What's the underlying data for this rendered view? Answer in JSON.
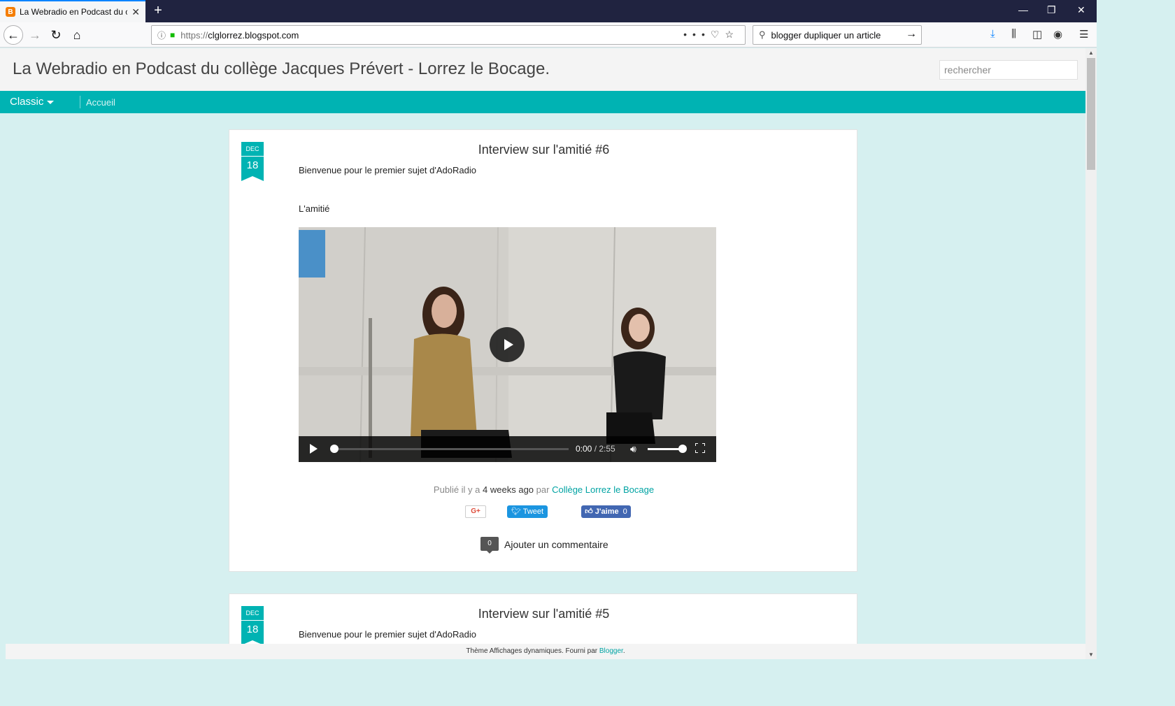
{
  "browser": {
    "tab_title": "La Webradio en Podcast du coll",
    "url_protocol": "https://",
    "url_host": "clglorrez.blogspot.com",
    "search_query": "blogger dupliquer un article"
  },
  "site": {
    "title": "La Webradio en Podcast du collège Jacques Prévert - Lorrez le Bocage.",
    "search_placeholder": "rechercher"
  },
  "menu": {
    "view_label": "Classic",
    "accueil": "Accueil"
  },
  "posts": [
    {
      "month": "DEC",
      "day": "18",
      "title": "Interview sur l'amitié #6",
      "intro": "Bienvenue pour le premier sujet d'AdoRadio",
      "subtitle": "L'amitié",
      "video": {
        "current_time": "0:00",
        "duration": "2:55",
        "progress": 0,
        "volume": 1.0
      },
      "meta_prefix": "Publié il y a",
      "meta_when": "4 weeks ago",
      "meta_by": "par",
      "author": "Collège Lorrez le Bocage",
      "share": {
        "gplus": "G+",
        "tweet": "Tweet",
        "like": "J'aime",
        "like_count": "0"
      },
      "comment_count": "0",
      "comment_label": "Ajouter un commentaire"
    },
    {
      "month": "DEC",
      "day": "18",
      "title": "Interview sur l'amitié #5",
      "intro": "Bienvenue pour le premier sujet d'AdoRadio"
    }
  ],
  "footer": {
    "text": "Thème Affichages dynamiques. Fourni par",
    "link": "Blogger",
    "end": "."
  },
  "colors": {
    "accent": "#00b3b3",
    "page_bg": "#d6f0f0",
    "twitter": "#1b95e0",
    "facebook": "#4267b2"
  },
  "icons": [
    "blogger-favicon-icon",
    "close-icon",
    "plus-icon",
    "back-icon",
    "forward-icon",
    "reload-icon",
    "home-icon",
    "info-icon",
    "lock-icon",
    "more-icon",
    "pocket-icon",
    "star-icon",
    "search-icon",
    "arrow-right-icon",
    "download-icon",
    "library-icon",
    "sidebar-icon",
    "extension-icon",
    "menu-icon",
    "play-icon",
    "volume-icon",
    "fullscreen-icon"
  ]
}
